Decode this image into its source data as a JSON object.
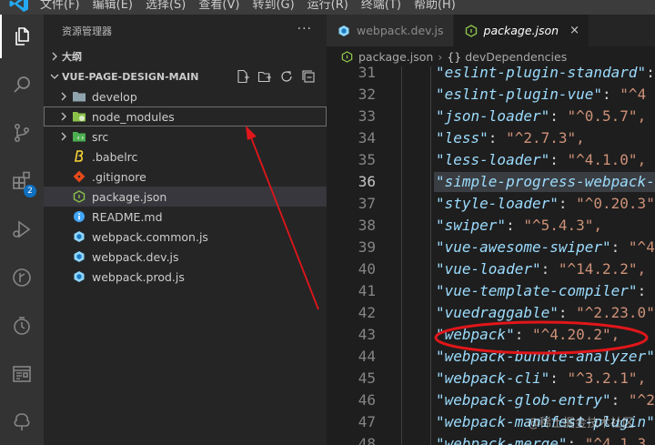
{
  "menu": {
    "items": [
      "文件(F)",
      "编辑(E)",
      "选择(S)",
      "查看(V)",
      "转到(G)",
      "运行(R)",
      "终端(T)",
      "帮助(H)"
    ]
  },
  "activity_bar": {
    "items": [
      "explorer-icon",
      "search-icon",
      "source-control-icon",
      "extensions-icon",
      "run-debug-icon",
      "git-graph-icon",
      "timeline-icon",
      "remote-explorer-icon",
      "tree-icon"
    ],
    "extensions_badge": "2"
  },
  "sidebar": {
    "title": "资源管理器",
    "more": "···",
    "outline_section": "大纲",
    "project_section": "VUE-PAGE-DESIGN-MAIN",
    "tree": [
      {
        "label": "develop",
        "kind": "folder"
      },
      {
        "label": "node_modules",
        "kind": "folder"
      },
      {
        "label": "src",
        "kind": "folder"
      },
      {
        "label": ".babelrc",
        "kind": "file"
      },
      {
        "label": ".gitignore",
        "kind": "file"
      },
      {
        "label": "package.json",
        "kind": "file"
      },
      {
        "label": "README.md",
        "kind": "file"
      },
      {
        "label": "webpack.common.js",
        "kind": "file"
      },
      {
        "label": "webpack.dev.js",
        "kind": "file"
      },
      {
        "label": "webpack.prod.js",
        "kind": "file"
      }
    ]
  },
  "tabs": [
    {
      "label": "webpack.dev.js"
    },
    {
      "label": "package.json",
      "close": "×"
    }
  ],
  "breadcrumb": {
    "file": "package.json",
    "sep": "›",
    "node_icon": "{}",
    "node": "devDependencies"
  },
  "editor": {
    "lines": [
      {
        "n": "31",
        "key": "\"eslint-plugin-standard\"",
        "rest": ": \""
      },
      {
        "n": "32",
        "key": "\"eslint-plugin-vue\"",
        "rest": ": \"^4"
      },
      {
        "n": "33",
        "key": "\"json-loader\"",
        "rest": ": \"^0.5.7\","
      },
      {
        "n": "34",
        "key": "\"less\"",
        "rest": ": \"^2.7.3\","
      },
      {
        "n": "35",
        "key": "\"less-loader\"",
        "rest": ": \"^4.1.0\","
      },
      {
        "n": "36",
        "key": "\"simple-progress-webpack-",
        "rest": ""
      },
      {
        "n": "37",
        "key": "\"style-loader\"",
        "rest": ": \"^0.20.3\""
      },
      {
        "n": "38",
        "key": "\"swiper\"",
        "rest": ": \"^5.4.3\","
      },
      {
        "n": "39",
        "key": "\"vue-awesome-swiper\"",
        "rest": ": \"^4"
      },
      {
        "n": "40",
        "key": "\"vue-loader\"",
        "rest": ": \"^14.2.2\","
      },
      {
        "n": "41",
        "key": "\"vue-template-compiler\"",
        "rest": ": "
      },
      {
        "n": "42",
        "key": "\"vuedraggable\"",
        "rest": ": \"^2.23.0\""
      },
      {
        "n": "43",
        "key": "\"webpack\"",
        "rest": ": \"^4.20.2\","
      },
      {
        "n": "44",
        "key": "\"webpack-bundle-analyzer\"",
        "rest": ""
      },
      {
        "n": "45",
        "key": "\"webpack-cli\"",
        "rest": ": \"^3.2.1\","
      },
      {
        "n": "46",
        "key": "\"webpack-glob-entry\"",
        "rest": ": \"^2"
      },
      {
        "n": "47",
        "key": "\"webpack-manifest-plugin\"",
        "rest": ""
      },
      {
        "n": "48",
        "key": "\"webpack-merge\"",
        "rest": ": \"^4.1.3"
      }
    ],
    "current_line": "36",
    "highlighted_line": "36"
  },
  "annotations": {
    "ellipse_target": "\"webpack\": \"^4.20.2\"",
    "arrow_target": "node_modules",
    "color": "#e0161a"
  },
  "watermark": "@稀土掘金技术社区"
}
